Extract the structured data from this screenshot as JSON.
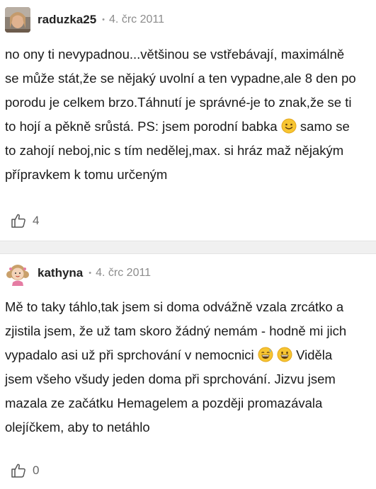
{
  "comments": [
    {
      "author": "raduzka25",
      "separator": "•",
      "date": "4. črc 2011",
      "text_parts": [
        "no ony ti nevypadnou...většinou se vstřebávají, maximálně se může stát,že se nějaký uvolní a ten vypadne,ale 8 den po porodu je celkem brzo.Táhnutí je správné-je to znak,že se ti to hojí a pěkně srůstá. PS: jsem porodní babka ",
        " samo se to zahojí neboj,nic s tím nedělej,max. si hráz maž nějakým přípravkem k tomu určeným"
      ],
      "likes": "4",
      "avatar_icon": "user-photo-avatar",
      "emojis": [
        "slightly-smiling-face-icon"
      ]
    },
    {
      "author": "kathyna",
      "separator": "•",
      "date": "4. črc 2011",
      "text_parts": [
        "Mě to taky táhlo,tak jsem si doma odvážně vzala zrcátko a zjistila jsem, že už tam skoro žádný nemám - hodně mi jich vypadalo asi už při sprchování v nemocnici ",
        " Viděla jsem všeho všudy jeden doma při sprchování. Jizvu jsem mazala ze začátku Hemagelem a později promazávala olejíčkem, aby to netáhlo"
      ],
      "likes": "0",
      "avatar_icon": "cartoon-girl-avatar",
      "emojis": [
        "grinning-sweat-face-icon",
        "grinning-face-icon"
      ]
    }
  ],
  "colors": {
    "emoji_yellow": "#f7c531",
    "separator_bg": "#f0f0f0",
    "date_gray": "#8c8c8c"
  }
}
